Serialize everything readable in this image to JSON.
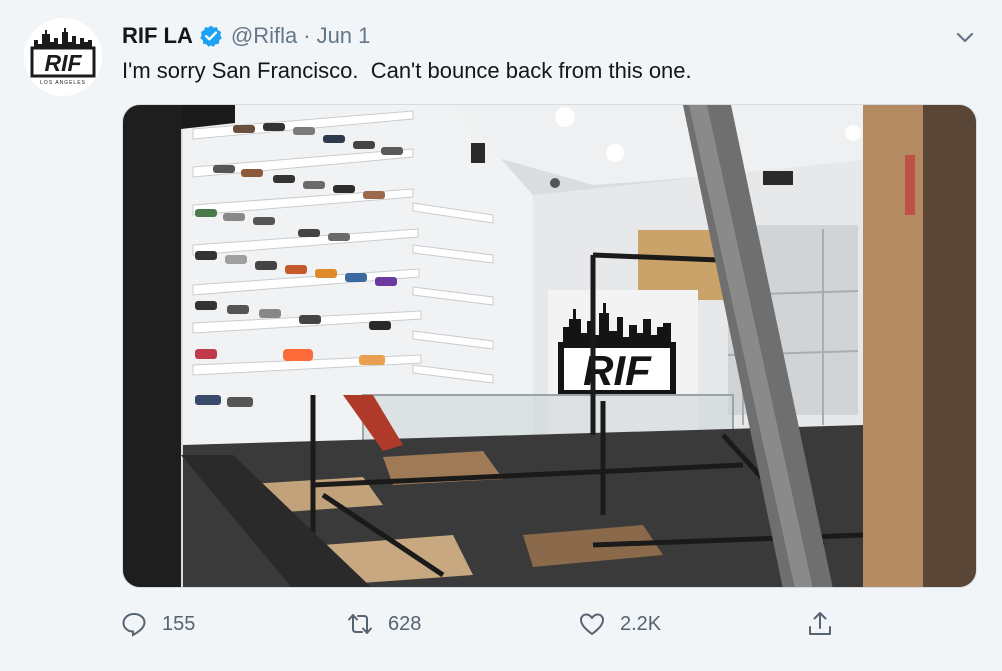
{
  "tweet": {
    "name": "RIF LA",
    "handle": "@Rifla",
    "separator": "·",
    "date": "Jun 1",
    "text": "I'm sorry San Francisco.  Can't bounce back from this one.",
    "avatar": {
      "logo_text": "RIF",
      "subtext": "LOS ANGELES"
    },
    "media": {
      "sign_text": "RIF"
    },
    "icons": {
      "verified": "verified-badge-icon",
      "more": "chevron-down-icon",
      "reply": "reply-icon",
      "retweet": "retweet-icon",
      "like": "heart-icon",
      "share": "share-icon"
    },
    "stats": {
      "replies": "155",
      "retweets": "628",
      "likes": "2.2K"
    },
    "colors": {
      "verified": "#1da1f2",
      "muted": "#657786",
      "background": "#f2f5f8"
    }
  }
}
